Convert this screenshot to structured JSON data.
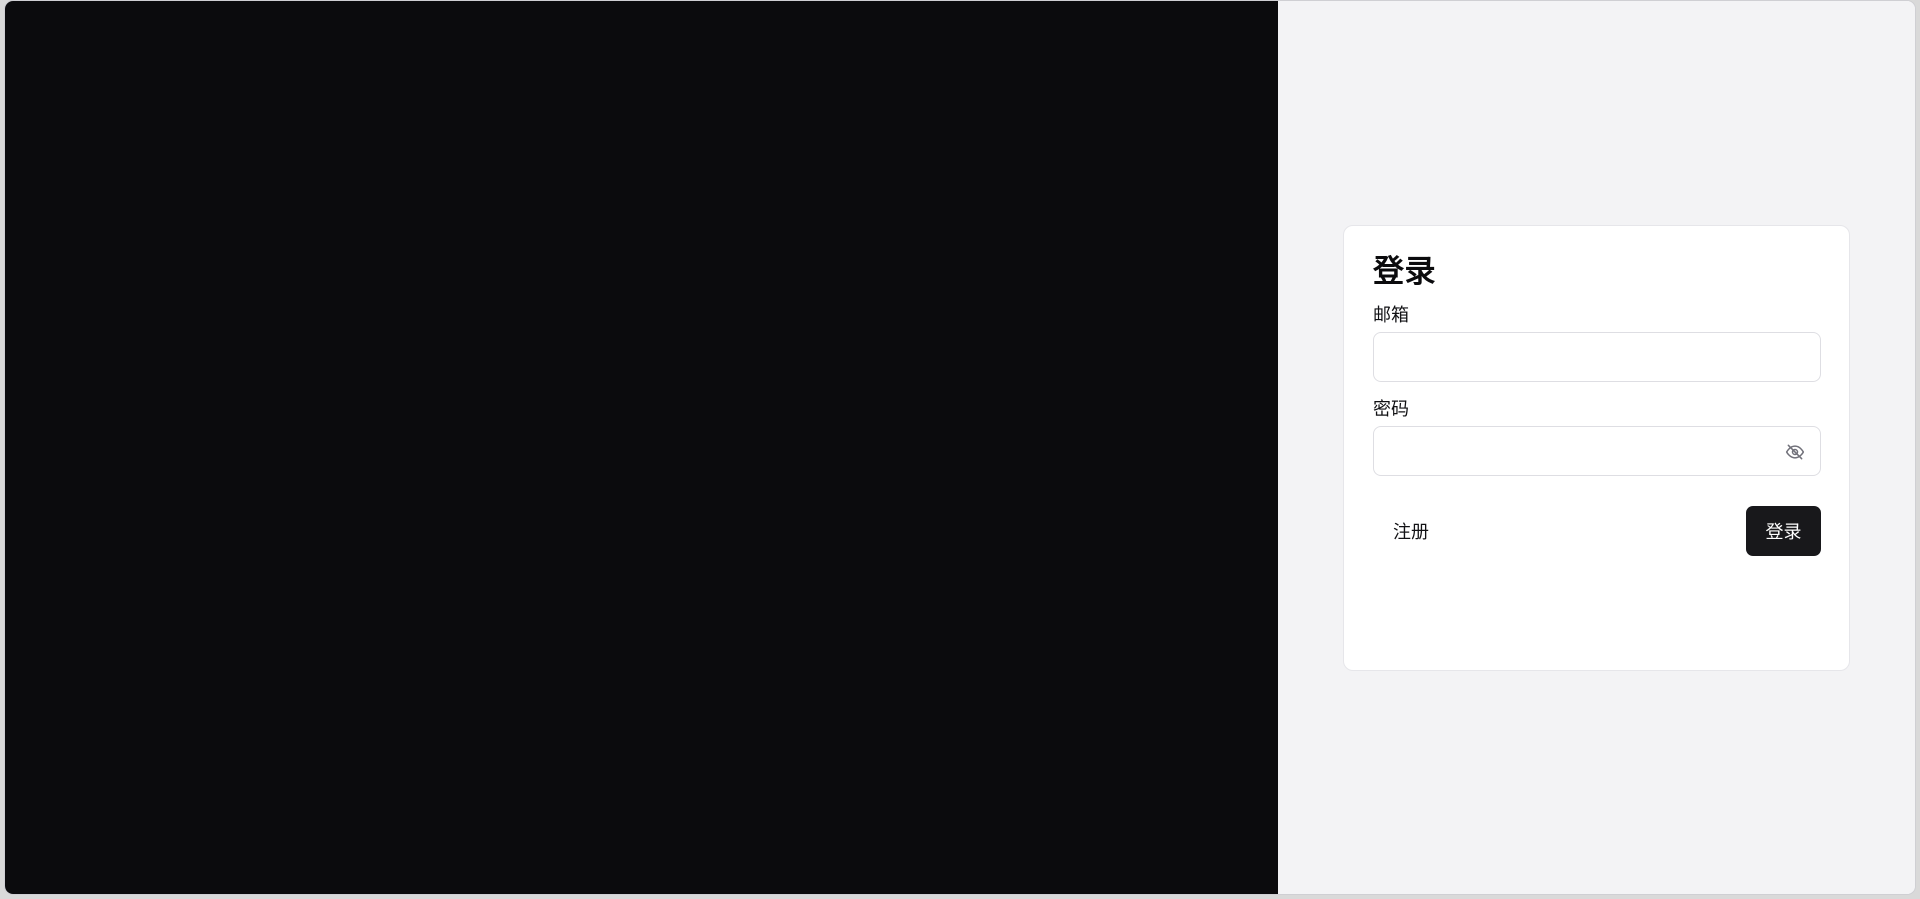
{
  "login": {
    "title": "登录",
    "email": {
      "label": "邮箱",
      "value": "",
      "placeholder": ""
    },
    "password": {
      "label": "密码",
      "value": "",
      "placeholder": "",
      "toggle_icon": "eye-off-icon"
    },
    "actions": {
      "register_label": "注册",
      "login_label": "登录"
    }
  },
  "colors": {
    "left_panel": "#0b0b0d",
    "page_background": "#f3f3f5",
    "card_background": "#ffffff",
    "primary_button": "#18181b",
    "text": "#111114"
  }
}
